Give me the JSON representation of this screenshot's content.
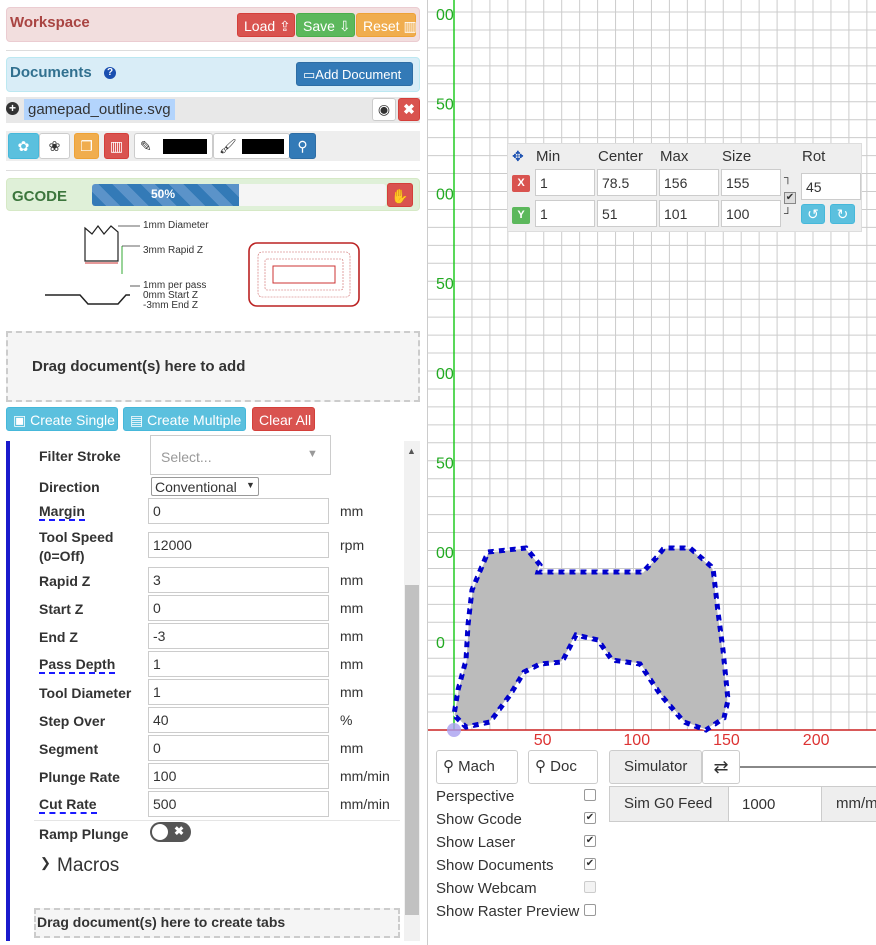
{
  "workspace": {
    "title": "Workspace",
    "load": "Load",
    "save": "Save",
    "reset": "Reset"
  },
  "documents": {
    "title": "Documents",
    "add": "Add Document",
    "file": "gamepad_outline.svg"
  },
  "gcode": {
    "title": "GCODE",
    "progress_label": "50%",
    "progress": 0.5
  },
  "diagram": {
    "diameter": "1mm Diameter",
    "rapid": "3mm Rapid Z",
    "per_pass": "1mm per pass",
    "start": "0mm Start Z",
    "end": "-3mm End Z"
  },
  "drop1": "Drag document(s) here to add",
  "ops": {
    "single": "Create Single",
    "multiple": "Create Multiple",
    "clear": "Clear All"
  },
  "form": {
    "filter_stroke": "Filter Stroke",
    "filter_placeholder": "Select...",
    "direction": "Direction",
    "direction_value": "Conventional",
    "rows": [
      {
        "label": "Margin",
        "value": "0",
        "unit": "mm"
      },
      {
        "label": "Tool Speed",
        "label2": "(0=Off)",
        "value": "12000",
        "unit": "rpm"
      },
      {
        "label": "Rapid Z",
        "value": "3",
        "unit": "mm"
      },
      {
        "label": "Start Z",
        "value": "0",
        "unit": "mm"
      },
      {
        "label": "End Z",
        "value": "-3",
        "unit": "mm"
      },
      {
        "label": "Pass Depth",
        "value": "1",
        "unit": "mm"
      },
      {
        "label": "Tool Diameter",
        "value": "1",
        "unit": "mm"
      },
      {
        "label": "Step Over",
        "value": "40",
        "unit": "%"
      },
      {
        "label": "Segment",
        "value": "0",
        "unit": "mm"
      },
      {
        "label": "Plunge Rate",
        "value": "100",
        "unit": "mm/min"
      },
      {
        "label": "Cut Rate",
        "value": "500",
        "unit": "mm/min"
      }
    ],
    "ramp": "Ramp Plunge",
    "macros": "Macros",
    "drop2": "Drag document(s) here to create tabs"
  },
  "transform": {
    "headers": [
      "Min",
      "Center",
      "Max",
      "Size",
      "Rot"
    ],
    "x": {
      "axis": "X",
      "min": "1",
      "center": "78.5",
      "max": "156",
      "size": "155"
    },
    "y": {
      "axis": "Y",
      "min": "1",
      "center": "51",
      "max": "101",
      "size": "100"
    },
    "rot": "45"
  },
  "axis": {
    "x_ticks": [
      "50",
      "100",
      "150",
      "200"
    ],
    "y_ticks": [
      "00",
      "50",
      "00",
      "50",
      "00",
      "50",
      "00",
      "0"
    ]
  },
  "view": {
    "mach": "Mach",
    "doc": "Doc",
    "simulator": "Simulator",
    "sim_g0": "Sim G0 Feed",
    "sim_g0_value": "1000",
    "sim_unit": "mm/m"
  },
  "options": [
    {
      "label": "Perspective",
      "checked": ""
    },
    {
      "label": "Show Gcode",
      "checked": "✔"
    },
    {
      "label": "Show Laser",
      "checked": "✔"
    },
    {
      "label": "Show Documents",
      "checked": "✔"
    },
    {
      "label": "Show Webcam",
      "checked": ""
    },
    {
      "label": "Show Raster Preview",
      "checked": ""
    }
  ]
}
